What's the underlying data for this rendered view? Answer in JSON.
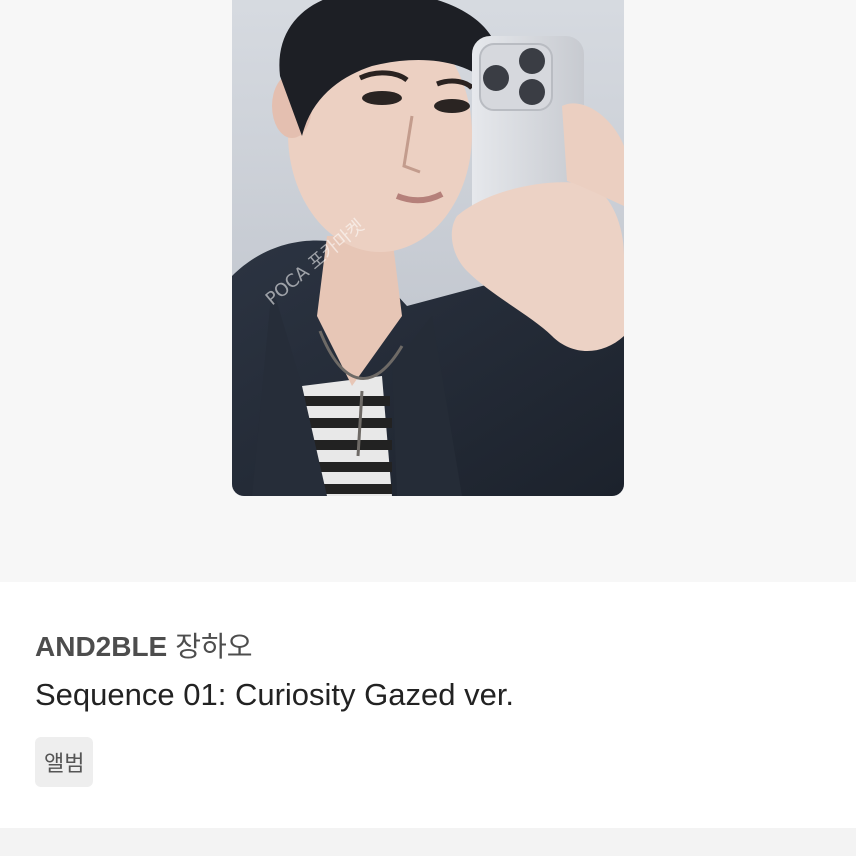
{
  "photo": {
    "watermark": "POCA 포카마켓"
  },
  "product": {
    "group": "AND2BLE",
    "member": "장하오",
    "album": "Sequence 01: Curiosity Gazed ver.",
    "tag": "앨범"
  }
}
